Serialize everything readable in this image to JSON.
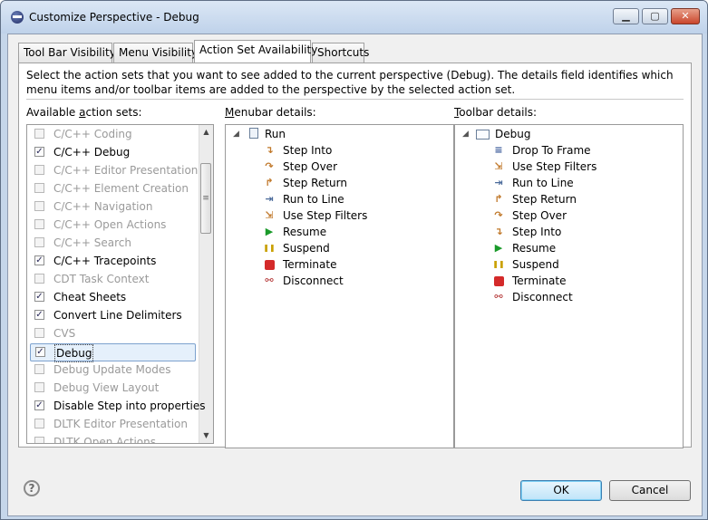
{
  "window": {
    "title": "Customize Perspective - Debug",
    "controls": {
      "minimize": "▁",
      "maximize": "▢",
      "close": "✕"
    }
  },
  "tabs": [
    {
      "label": "Tool Bar Visibility",
      "active": false
    },
    {
      "label": "Menu Visibility",
      "active": false
    },
    {
      "label": "Action Set Availability",
      "active": true
    },
    {
      "label": "Shortcuts",
      "active": false
    }
  ],
  "description": "Select the action sets that you want to see added to the current perspective (Debug).  The details field identifies which menu items and/or toolbar items are added to the perspective by the selected action set.",
  "available": {
    "label_pre": "Available ",
    "label_u": "a",
    "label_post": "ction sets:",
    "items": [
      {
        "label": "C/C++ Coding",
        "checked": false,
        "enabled": false
      },
      {
        "label": "C/C++ Debug",
        "checked": true,
        "enabled": true
      },
      {
        "label": "C/C++ Editor Presentation",
        "checked": false,
        "enabled": false
      },
      {
        "label": "C/C++ Element Creation",
        "checked": false,
        "enabled": false
      },
      {
        "label": "C/C++ Navigation",
        "checked": false,
        "enabled": false
      },
      {
        "label": "C/C++ Open Actions",
        "checked": false,
        "enabled": false
      },
      {
        "label": "C/C++ Search",
        "checked": false,
        "enabled": false
      },
      {
        "label": "C/C++ Tracepoints",
        "checked": true,
        "enabled": true
      },
      {
        "label": "CDT Task Context",
        "checked": false,
        "enabled": false
      },
      {
        "label": "Cheat Sheets",
        "checked": true,
        "enabled": true
      },
      {
        "label": "Convert Line Delimiters",
        "checked": true,
        "enabled": true
      },
      {
        "label": "CVS",
        "checked": false,
        "enabled": false
      },
      {
        "label": "Debug",
        "checked": true,
        "enabled": true,
        "selected": true
      },
      {
        "label": "Debug Update Modes",
        "checked": false,
        "enabled": false
      },
      {
        "label": "Debug View Layout",
        "checked": false,
        "enabled": false
      },
      {
        "label": "Disable Step into properties",
        "checked": true,
        "enabled": true
      },
      {
        "label": "DLTK Editor Presentation",
        "checked": false,
        "enabled": false
      },
      {
        "label": "DLTK Open Actions",
        "checked": false,
        "enabled": false
      }
    ]
  },
  "menubar": {
    "label_u": "M",
    "label_post": "enubar details:",
    "root": {
      "label": "Run",
      "icon": "run-menu-icon"
    },
    "children": [
      {
        "label": "Step Into",
        "icon": "step-into-icon",
        "glyph": "↴"
      },
      {
        "label": "Step Over",
        "icon": "step-over-icon",
        "glyph": "↷"
      },
      {
        "label": "Step Return",
        "icon": "step-return-icon",
        "glyph": "↱"
      },
      {
        "label": "Run to Line",
        "icon": "run-to-line-icon",
        "glyph": "⇥"
      },
      {
        "label": "Use Step Filters",
        "icon": "step-filters-icon",
        "glyph": "⇲"
      },
      {
        "label": "Resume",
        "icon": "resume-icon",
        "glyph": "▶"
      },
      {
        "label": "Suspend",
        "icon": "suspend-icon",
        "glyph": "❚❚"
      },
      {
        "label": "Terminate",
        "icon": "terminate-icon",
        "glyph": ""
      },
      {
        "label": "Disconnect",
        "icon": "disconnect-icon",
        "glyph": "⚯"
      }
    ]
  },
  "toolbar": {
    "label_u": "T",
    "label_post": "oolbar details:",
    "root": {
      "label": "Debug",
      "icon": "debug-toolbar-icon"
    },
    "children": [
      {
        "label": "Drop To Frame",
        "icon": "drop-to-frame-icon",
        "glyph": "≡"
      },
      {
        "label": "Use Step Filters",
        "icon": "step-filters-icon",
        "glyph": "⇲"
      },
      {
        "label": "Run to Line",
        "icon": "run-to-line-icon",
        "glyph": "⇥"
      },
      {
        "label": "Step Return",
        "icon": "step-return-icon",
        "glyph": "↱"
      },
      {
        "label": "Step Over",
        "icon": "step-over-icon",
        "glyph": "↷"
      },
      {
        "label": "Step Into",
        "icon": "step-into-icon",
        "glyph": "↴"
      },
      {
        "label": "Resume",
        "icon": "resume-icon",
        "glyph": "▶"
      },
      {
        "label": "Suspend",
        "icon": "suspend-icon",
        "glyph": "❚❚"
      },
      {
        "label": "Terminate",
        "icon": "terminate-icon",
        "glyph": ""
      },
      {
        "label": "Disconnect",
        "icon": "disconnect-icon",
        "glyph": "⚯"
      }
    ]
  },
  "buttons": {
    "ok": "OK",
    "cancel": "Cancel",
    "help": "?"
  }
}
